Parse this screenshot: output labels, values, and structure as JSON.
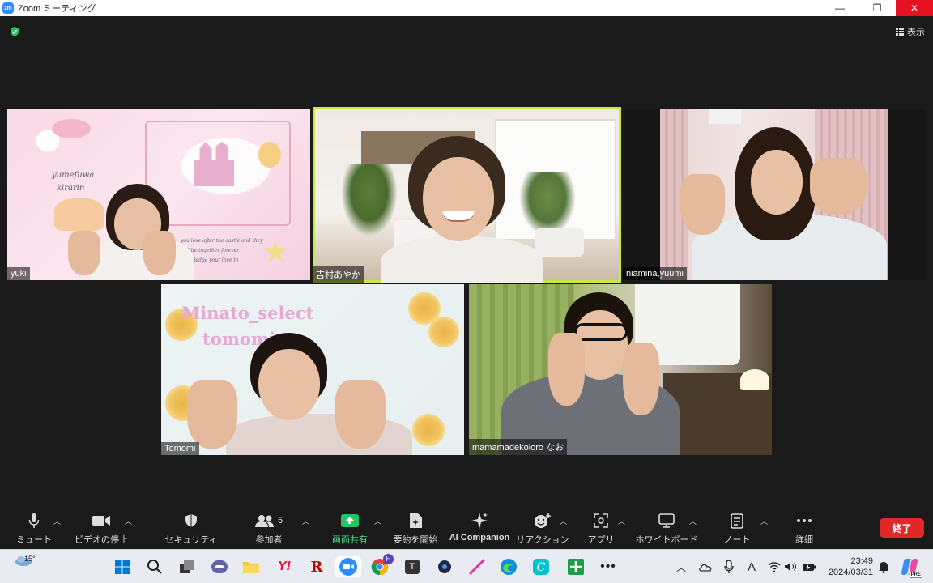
{
  "window": {
    "title": "Zoom ミーティング",
    "logo_text": "zm"
  },
  "top": {
    "view_label": "表示"
  },
  "participants": [
    {
      "name": "yuki"
    },
    {
      "name": "吉村あやか"
    },
    {
      "name": "niamina,yuumi"
    },
    {
      "name": "Tomomi"
    },
    {
      "name": "mamamadekoloro なお"
    }
  ],
  "backgrounds": {
    "yuki_text": [
      "yumefuwa",
      "kirarin"
    ],
    "yuki_script": [
      "you love after the castle and they",
      "will be together forever",
      "you pledge your love to"
    ],
    "tomomi_text": [
      "Minato_select",
      "tomomi"
    ]
  },
  "toolbar": {
    "mute": "ミュート",
    "video": "ビデオの停止",
    "security": "セキュリティ",
    "participants": "参加者",
    "participants_count": "5",
    "share": "画面共有",
    "summary": "要約を開始",
    "ai": "AI Companion",
    "reactions": "リアクション",
    "apps": "アプリ",
    "whiteboard": "ホワイトボード",
    "notes": "ノート",
    "more": "詳細",
    "end": "終了"
  },
  "taskbar": {
    "temperature": "15°",
    "time": "23:49",
    "date": "2024/03/31",
    "chrome_badge": "H",
    "ime": "A",
    "copilot_badge": "PRE"
  },
  "colors": {
    "active_border": "#c9e64a",
    "end_button": "#e02828",
    "share_icon": "#22c55e",
    "zoom_blue": "#2d8cff"
  }
}
